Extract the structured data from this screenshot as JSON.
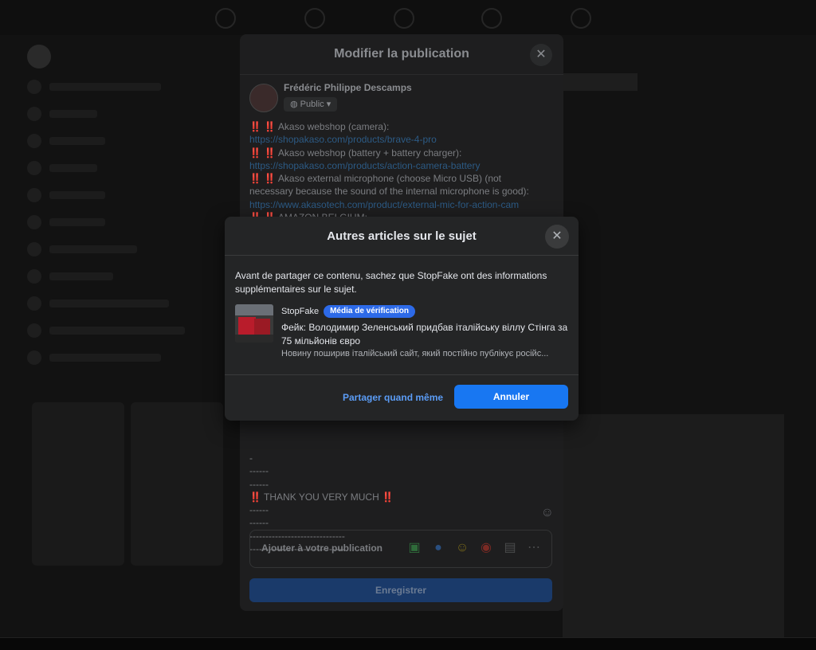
{
  "edit_modal": {
    "title": "Modifier la publication",
    "author": "Frédéric Philippe Descamps",
    "audience": "Public",
    "lines": [
      {
        "text": "Akaso webshop (camera):",
        "type": "text"
      },
      {
        "text": "https://shopakaso.com/products/brave-4-pro",
        "type": "link"
      },
      {
        "text": "Akaso webshop (battery + battery charger):",
        "type": "text"
      },
      {
        "text": "https://shopakaso.com/products/action-camera-battery",
        "type": "link"
      },
      {
        "text": "Akaso external microphone (choose Micro USB) (not",
        "type": "text"
      },
      {
        "text": "necessary because the sound of the internal microphone is good):",
        "type": "text"
      },
      {
        "text": "https://www.akasotech.com/product/external-mic-for-action-cam",
        "type": "link"
      },
      {
        "text": "AMAZON BELGIUM:",
        "type": "text"
      }
    ],
    "lower_lines": [
      "-",
      "------",
      "------",
      "‼️ THANK YOU VERY MUCH ‼️",
      "------",
      "------",
      "------------------------------",
      "------------------------------"
    ],
    "add_label": "Ajouter à votre publication",
    "save_label": "Enregistrer"
  },
  "dialog": {
    "title": "Autres articles sur le sujet",
    "intro": "Avant de partager ce contenu, sachez que StopFake ont des informations supplémentaires sur le sujet.",
    "article": {
      "source": "StopFake",
      "badge": "Média de vérification",
      "title": "Фейк: Володимир Зеленський придбав італійську віллу Стінга за 75 мільйонів євро",
      "snippet": "Новину поширив італійський сайт, який постійно публікує російс..."
    },
    "share_label": "Partager quand même",
    "cancel_label": "Annuler"
  }
}
